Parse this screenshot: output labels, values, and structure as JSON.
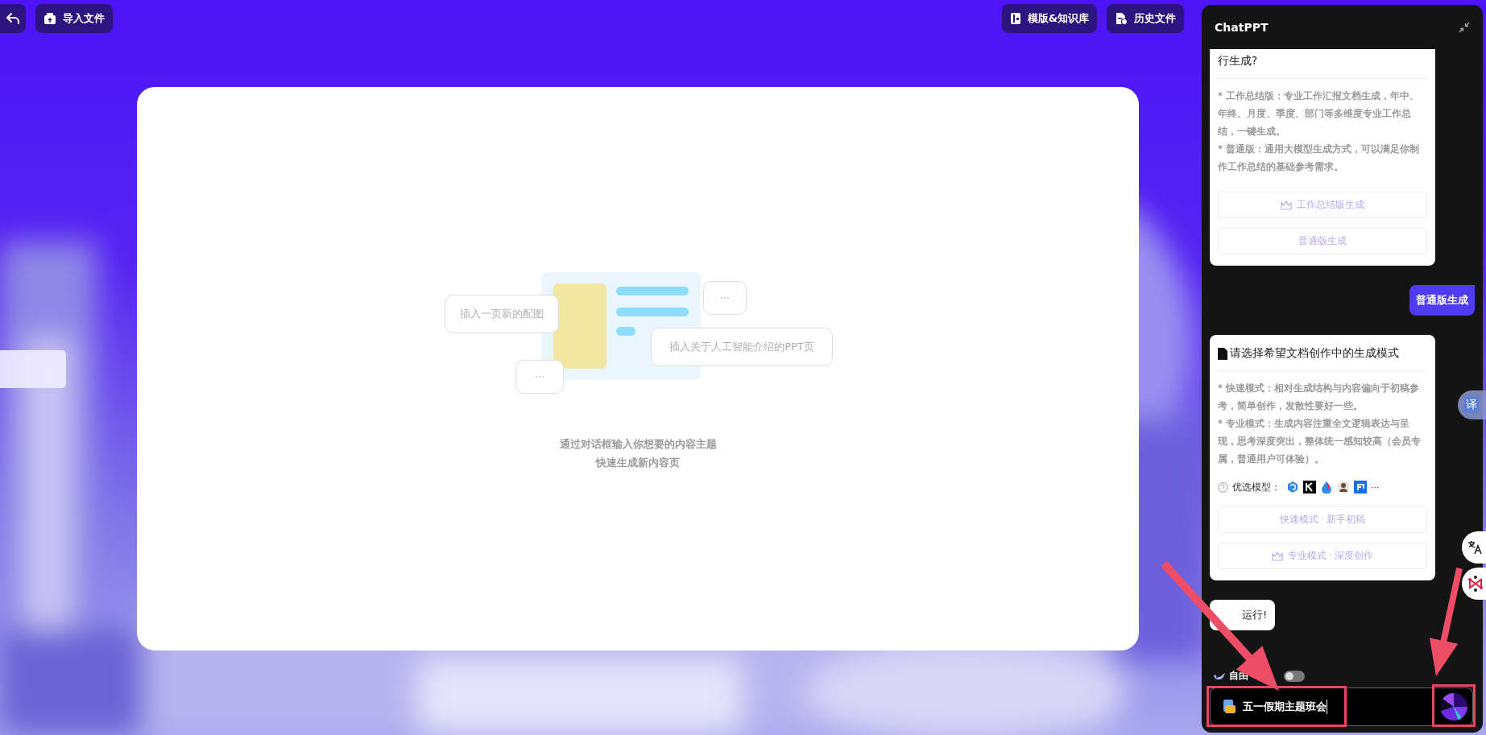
{
  "toolbar": {
    "left_buttons": [
      {
        "label": "导入文件"
      }
    ],
    "right_buttons": [
      {
        "label": "模版&知识库"
      },
      {
        "label": "历史文件"
      }
    ]
  },
  "canvas": {
    "bubbles": [
      {
        "kind": "left",
        "text": "插入一页新的配图"
      },
      {
        "kind": "top-right",
        "text": "···"
      },
      {
        "kind": "right",
        "text": "插入关于人工智能介绍的PPT页"
      },
      {
        "kind": "bottom-left",
        "text": "···"
      }
    ],
    "hint_lines": [
      "通过对话框输入你想要的内容主题",
      "快速生成新内容页"
    ]
  },
  "chat": {
    "title": "ChatPPT",
    "messages": [
      {
        "kind": "card",
        "title": "行生成?",
        "title_icon": false,
        "paragraphs": [
          "* 工作总结版：专业工作汇报文档生成，年中、年终、月度、季度、部门等多维度专业工作总结，一键生成。",
          "* 普通版：通用大模型生成方式，可以满足你制作工作总结的基础参考需求。"
        ],
        "buttons": [
          {
            "label": "工作总结版生成",
            "icon": true
          },
          {
            "label": "普通版生成",
            "icon": false
          }
        ]
      },
      {
        "kind": "user",
        "text": "普通版生成"
      },
      {
        "kind": "card",
        "title": "请选择希望文档创作中的生成模式",
        "title_icon": true,
        "paragraphs": [
          "* 快速模式：相对生成结构与内容偏向于初稿参考，简单创作，发散性要好一些。",
          "* 专业模式：生成内容注重全文逻辑表达与呈现，思考深度突出，整体统一感知较高（会员专属，普通用户可体验）。"
        ],
        "models": {
          "label": "优选模型：",
          "more": "···"
        },
        "buttons": [
          {
            "label": "快速模式 · 新手初稿",
            "icon": false
          },
          {
            "label": "专业模式 · 深度创作",
            "icon": true
          }
        ]
      },
      {
        "kind": "bubble",
        "text": "运行!"
      }
    ],
    "free_chat": {
      "label": "自由",
      "on": false
    },
    "input": {
      "value": "五一假期主题班会"
    }
  },
  "side_tools": {
    "translate_label": "译"
  }
}
